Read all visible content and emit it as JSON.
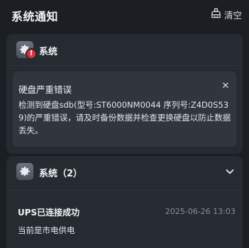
{
  "header": {
    "title": "系统通知",
    "clear_label": "清空",
    "clear_icon": "broom-icon"
  },
  "groups": [
    {
      "app_icon": "gear-icon",
      "title": "系统",
      "badge_symbol": "!",
      "notice": {
        "title": "硬盘严重错误",
        "body": "检测到硬盘sdb(型号:ST6000NM0044 序列号:Z4D0S539)的严重错误，请及时备份数据并检查更换硬盘以防止数据丢失。",
        "close_icon": "close-icon"
      }
    },
    {
      "app_icon": "gear-icon",
      "title": "系统（2）",
      "collapse_icon": "chevron-down-icon",
      "message": {
        "title": "UPS已连接成功",
        "time": "2025-06-26 13:03",
        "body": "当前是市电供电"
      }
    }
  ],
  "colors": {
    "background": "#1b1e23",
    "card": "#262a31",
    "notice": "#31363e",
    "error_badge": "#e5303c"
  }
}
